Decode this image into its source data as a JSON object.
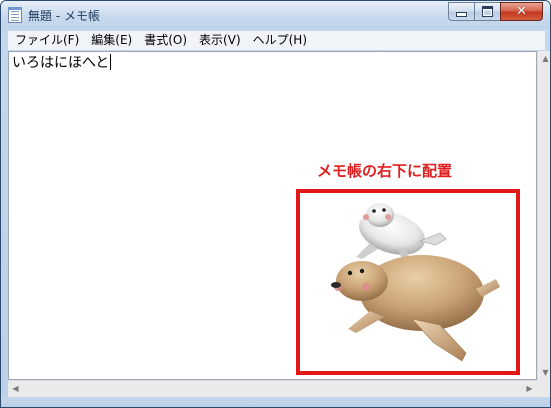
{
  "window": {
    "title": "無題 - メモ帳",
    "icon": "notepad-icon",
    "caption_buttons": {
      "minimize": "minimize-icon",
      "maximize": "maximize-icon",
      "close": "✕"
    }
  },
  "menu": {
    "items": [
      {
        "label": "ファイル(F)"
      },
      {
        "label": "編集(E)"
      },
      {
        "label": "書式(O)"
      },
      {
        "label": "表示(V)"
      },
      {
        "label": "ヘルプ(H)"
      }
    ]
  },
  "editor": {
    "text": "いろはにほへと"
  },
  "annotation": {
    "label": "メモ帳の右下に配置",
    "color": "#e01818"
  },
  "scrollbars": {
    "up": "▲",
    "down": "▼",
    "left": "◀",
    "right": "▶"
  },
  "overlay": {
    "image": "seals-illustration"
  }
}
